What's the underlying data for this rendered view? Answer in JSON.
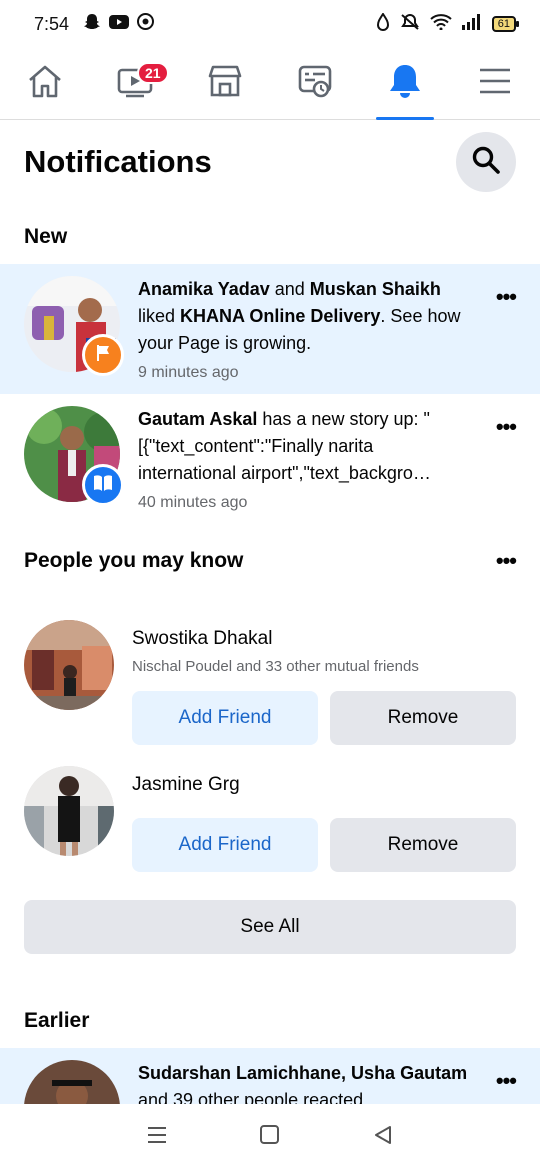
{
  "status_bar": {
    "time": "7:54",
    "battery": "61"
  },
  "nav": {
    "tabs": [
      {
        "name": "home",
        "icon": "home-icon"
      },
      {
        "name": "video",
        "icon": "video-icon",
        "badge": "21"
      },
      {
        "name": "marketplace",
        "icon": "marketplace-icon"
      },
      {
        "name": "feeds",
        "icon": "feeds-icon"
      },
      {
        "name": "notifications",
        "icon": "bell-icon",
        "active": true
      },
      {
        "name": "menu",
        "icon": "menu-icon"
      }
    ],
    "accent": "#1877f2"
  },
  "header": {
    "title": "Notifications"
  },
  "sections": {
    "new": "New",
    "pymk": "People you may know",
    "earlier": "Earlier"
  },
  "notifications": [
    {
      "bold1": "Anamika Yadav",
      "mid1": " and ",
      "bold2": "Muskan Shaikh",
      "mid2": " liked ",
      "bold3": "KHANA Online Delivery",
      "rest": ". See how your Page is growing.",
      "time": "9 minutes ago"
    },
    {
      "bold1": "Gautam Askal",
      "rest": " has a new story up: \"[{\"text_content\":\"Finally narita international airport\",\"text_backgro…",
      "time": "40 minutes ago"
    },
    {
      "bold1": "Sudarshan Lamichhane, Usha Gautam",
      "rest": " and 39 other people reacted"
    }
  ],
  "people": [
    {
      "name": "Swostika Dhakal",
      "mutual": "Nischal Poudel and 33 other mutual friends"
    },
    {
      "name": "Jasmine Grg",
      "mutual": ""
    }
  ],
  "buttons": {
    "add_friend": "Add Friend",
    "remove": "Remove",
    "see_all": "See All"
  },
  "more_glyph": "•••"
}
